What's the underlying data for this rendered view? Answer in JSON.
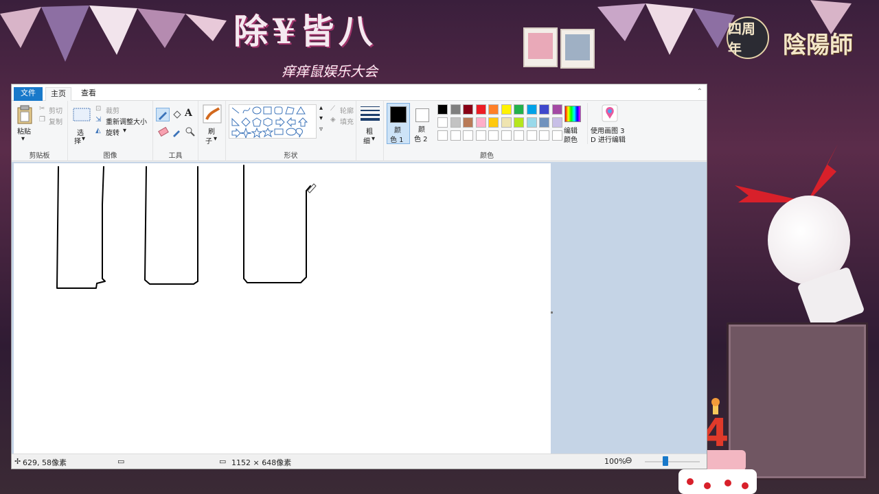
{
  "overlay": {
    "title": "除¥皆八",
    "subtitle": "痒痒鼠娱乐大会",
    "game_logo": "陰陽師",
    "anniversary_badge": "四周年",
    "cake_number": "4"
  },
  "window": {
    "tabs": [
      {
        "label": "文件",
        "active": false
      },
      {
        "label": "主页",
        "active": true
      },
      {
        "label": "查看",
        "active": false
      }
    ]
  },
  "ribbon": {
    "clipboard": {
      "paste": "粘贴",
      "cut": "剪切",
      "copy": "复制",
      "label": "剪贴板"
    },
    "image": {
      "select_line1": "选",
      "select_line2": "择",
      "crop": "裁剪",
      "resize": "重新调整大小",
      "rotate": "旋转",
      "label": "图像"
    },
    "tools": {
      "label": "工具"
    },
    "brushes": {
      "line1": "刷",
      "line2": "子"
    },
    "shapes": {
      "outline": "轮廓",
      "fill": "填充",
      "label": "形状"
    },
    "size": {
      "line1": "粗",
      "line2": "细"
    },
    "color1": {
      "line1": "颜",
      "line2": "色 1"
    },
    "color2": {
      "line1": "颜",
      "line2": "色 2"
    },
    "colors": {
      "label": "颜色",
      "row1": [
        "#000000",
        "#7f7f7f",
        "#880015",
        "#ed1c24",
        "#ff7f27",
        "#fff200",
        "#22b14c",
        "#00a2e8",
        "#3f48cc",
        "#a349a4"
      ],
      "row2": [
        "#ffffff",
        "#c3c3c3",
        "#b97a57",
        "#ffaec9",
        "#ffc90e",
        "#efe4b0",
        "#b5e61d",
        "#99d9ea",
        "#7092be",
        "#c8bfe7"
      ]
    },
    "edit_colors": {
      "line1": "编辑",
      "line2": "颜色"
    },
    "paint3d": {
      "line1": "使用画图 3",
      "line2": "D 进行编辑"
    }
  },
  "status": {
    "cursor_pos": "629, 58像素",
    "image_size": "1152 × 648像素",
    "zoom": "100%"
  }
}
